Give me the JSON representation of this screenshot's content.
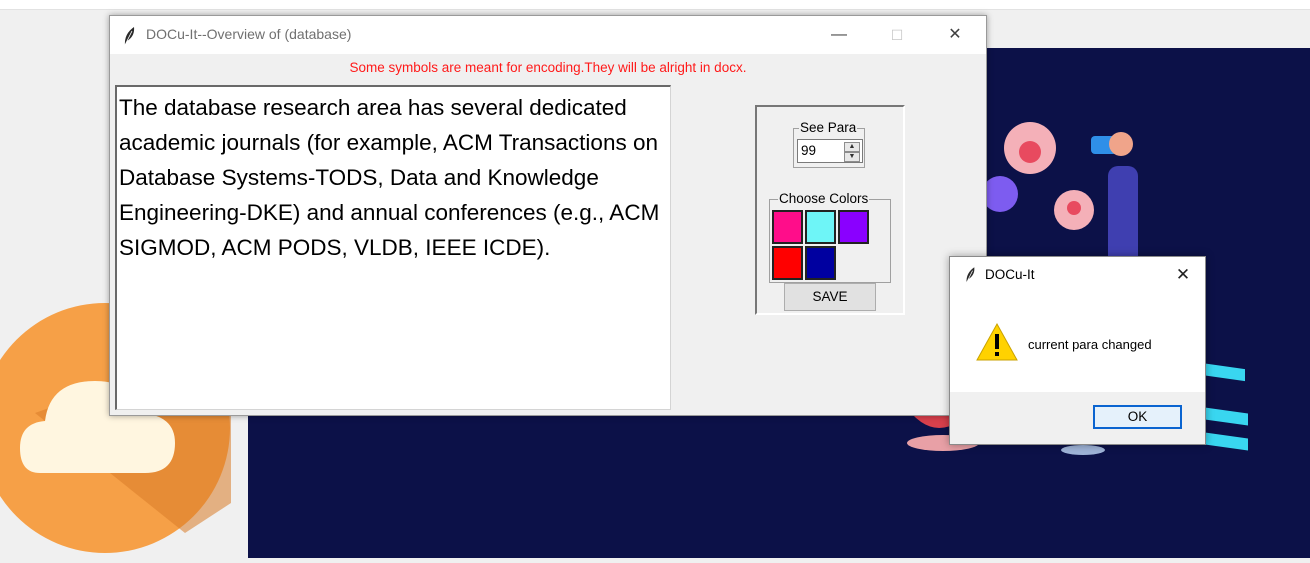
{
  "main_window": {
    "title": "DOCu-It--Overview of (database)",
    "warning": "Some symbols are meant for encoding.They will be alright in docx.",
    "paragraph_text": "The database research area has several dedicated academic journals (for example, ACM Transactions on Database Systems-TODS, Data and Knowledge Engineering-DKE) and annual conferences (e.g., ACM SIGMOD, ACM PODS, VLDB, IEEE ICDE).",
    "minimize_glyph": "—",
    "maximize_glyph": "☐",
    "close_glyph": "✕"
  },
  "panel": {
    "see_para_label": "See Para",
    "see_para_value": "99",
    "choose_colors_label": "Choose Colors",
    "colors": [
      "#ff0d8a",
      "#6ef5f7",
      "#8a00ff",
      "#ff0000",
      "#0000a0"
    ],
    "save_label": "SAVE"
  },
  "dialog": {
    "title": "DOCu-It",
    "message": "current para changed",
    "ok_label": "OK",
    "close_glyph": "✕"
  },
  "icons": {
    "app": "feather-icon",
    "warning": "warning-triangle-icon"
  }
}
